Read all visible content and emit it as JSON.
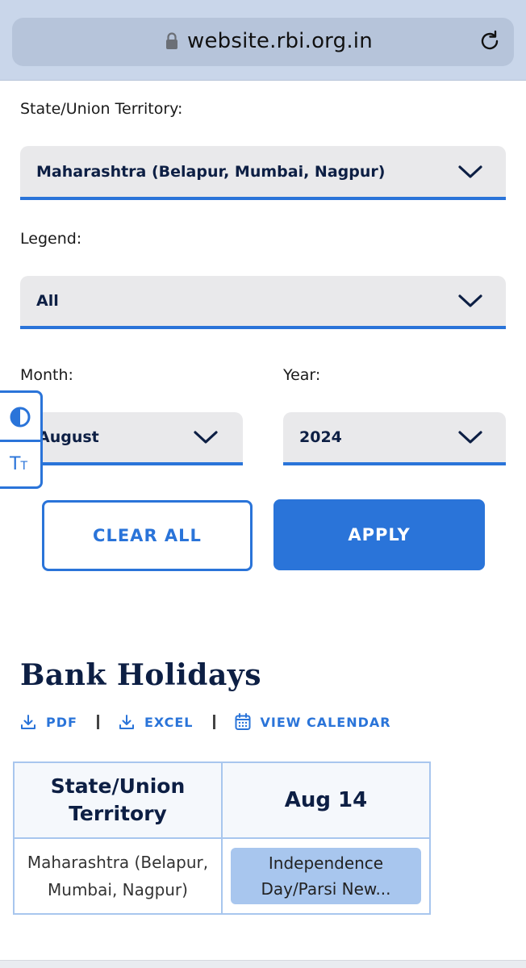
{
  "browser": {
    "url": "website.rbi.org.in"
  },
  "filters": {
    "state_label": "State/Union Territory:",
    "state_value": "Maharashtra (Belapur, Mumbai, Nagpur)",
    "legend_label": "Legend:",
    "legend_value": "All",
    "month_label": "Month:",
    "month_value": "August",
    "year_label": "Year:",
    "year_value": "2024",
    "clear_label": "CLEAR ALL",
    "apply_label": "APPLY"
  },
  "accessibility": {
    "text_size_main": "T",
    "text_size_small": "T"
  },
  "holidays": {
    "title": "Bank Holidays",
    "links": {
      "pdf": "PDF",
      "excel": "EXCEL",
      "calendar": "VIEW CALENDAR"
    },
    "table": {
      "header_state_line1": "State/Union",
      "header_state_line2": "Territory",
      "header_date": "Aug 14",
      "row_state_line1": "Maharashtra (Belapur,",
      "row_state_line2": "Mumbai, Nagpur)",
      "row_holiday_line1": "Independence",
      "row_holiday_line2": "Day/Parsi New..."
    }
  },
  "colors": {
    "accent": "#2a74d9",
    "heading": "#0d1f44",
    "badge": "#a8c6ee"
  }
}
